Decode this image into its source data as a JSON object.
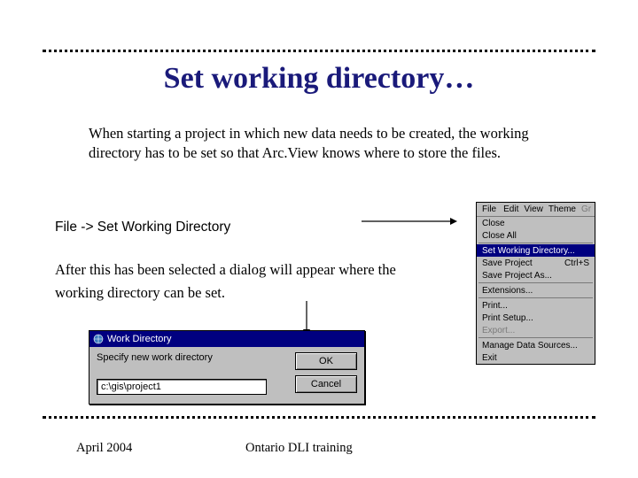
{
  "title": "Set working directory…",
  "intro": "When starting a project in which new data needs to be created, the working directory has to be set so that Arc.View knows where to store the files.",
  "step_label": "File -> Set Working Directory",
  "after_text": "After this has been selected a dialog will appear where the working directory can be set.",
  "footer": {
    "left": "April 2004",
    "center": "Ontario DLI training"
  },
  "menubar": {
    "items": [
      "File",
      "Edit",
      "View",
      "Theme",
      "Gr"
    ]
  },
  "filemenu": {
    "items": [
      {
        "label": "Close",
        "shortcut": "",
        "enabled": true,
        "hl": false
      },
      {
        "label": "Close All",
        "shortcut": "",
        "enabled": true,
        "hl": false
      },
      {
        "sep": true
      },
      {
        "label": "Set Working Directory...",
        "shortcut": "",
        "enabled": true,
        "hl": true
      },
      {
        "label": "Save Project",
        "shortcut": "Ctrl+S",
        "enabled": true,
        "hl": false
      },
      {
        "label": "Save Project As...",
        "shortcut": "",
        "enabled": true,
        "hl": false
      },
      {
        "sep": true
      },
      {
        "label": "Extensions...",
        "shortcut": "",
        "enabled": true,
        "hl": false
      },
      {
        "sep": true
      },
      {
        "label": "Print...",
        "shortcut": "",
        "enabled": true,
        "hl": false
      },
      {
        "label": "Print Setup...",
        "shortcut": "",
        "enabled": true,
        "hl": false
      },
      {
        "label": "Export...",
        "shortcut": "",
        "enabled": false,
        "hl": false
      },
      {
        "sep": true
      },
      {
        "label": "Manage Data Sources...",
        "shortcut": "",
        "enabled": true,
        "hl": false
      },
      {
        "label": "Exit",
        "shortcut": "",
        "enabled": true,
        "hl": false
      }
    ]
  },
  "dialog": {
    "title": "Work Directory",
    "prompt": "Specify new work directory",
    "value": "c:\\gis\\project1",
    "ok": "OK",
    "cancel": "Cancel"
  }
}
